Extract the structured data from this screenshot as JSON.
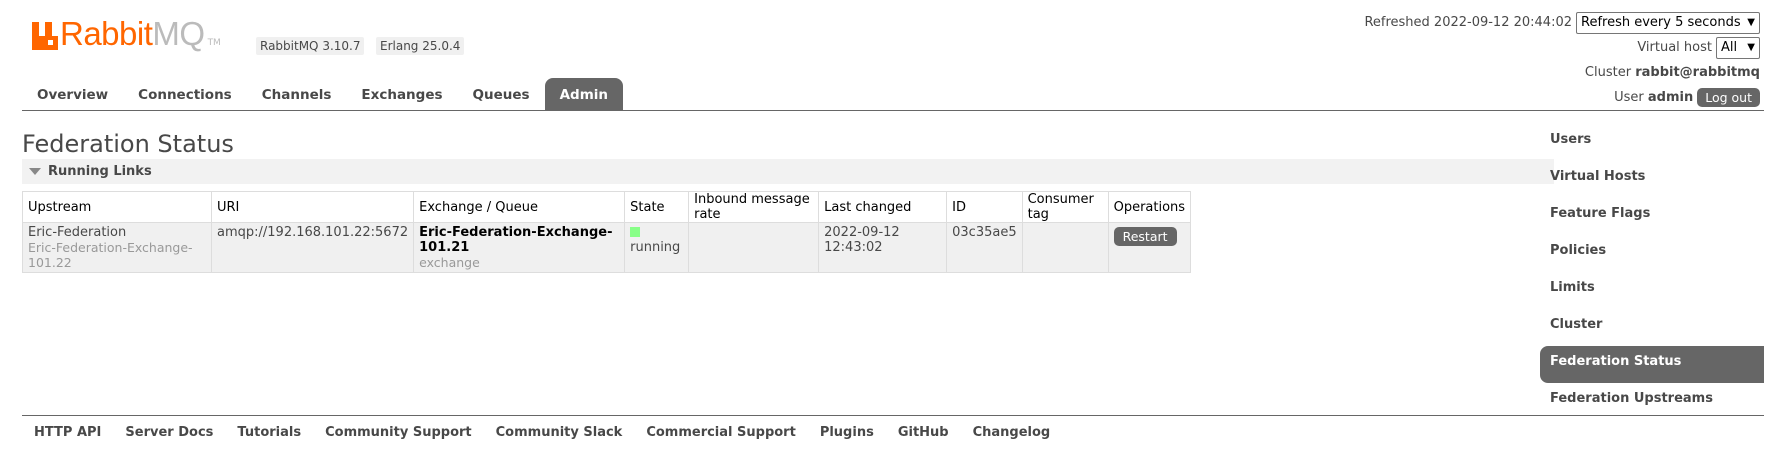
{
  "logo": {
    "rabbit": "Rabbit",
    "mq": "MQ",
    "tm": "TM"
  },
  "badges": {
    "rabbitmq": "RabbitMQ 3.10.7",
    "erlang": "Erlang 25.0.4"
  },
  "header": {
    "refreshed_label": "Refreshed",
    "refreshed_time": "2022-09-12 20:44:02",
    "refresh_select": "Refresh every 5 seconds",
    "vhost_label": "Virtual host",
    "vhost_select": "All",
    "cluster_label": "Cluster",
    "cluster_name": "rabbit@rabbitmq",
    "user_label": "User",
    "user_name": "admin",
    "logout": "Log out"
  },
  "tabs": [
    "Overview",
    "Connections",
    "Channels",
    "Exchanges",
    "Queues",
    "Admin"
  ],
  "active_tab": "Admin",
  "main": {
    "title": "Federation Status",
    "section": "Running Links",
    "columns": [
      "Upstream",
      "URI",
      "Exchange / Queue",
      "State",
      "Inbound message rate",
      "Last changed",
      "ID",
      "Consumer tag",
      "Operations"
    ],
    "rows": [
      {
        "upstream": "Eric-Federation",
        "upstream_sub": "Eric-Federation-Exchange-101.22",
        "uri": "amqp://192.168.101.22:5672",
        "exchange": "Eric-Federation-Exchange-101.21",
        "exchange_type": "exchange",
        "state": "running",
        "inbound_rate": "",
        "last_changed": "2022-09-12 12:43:02",
        "id": "03c35ae5",
        "consumer_tag": "",
        "operation": "Restart"
      }
    ]
  },
  "sidebar": [
    "Users",
    "Virtual Hosts",
    "Feature Flags",
    "Policies",
    "Limits",
    "Cluster",
    "Federation Status",
    "Federation Upstreams"
  ],
  "active_sidebar": "Federation Status",
  "footer": [
    "HTTP API",
    "Server Docs",
    "Tutorials",
    "Community Support",
    "Community Slack",
    "Commercial Support",
    "Plugins",
    "GitHub",
    "Changelog"
  ],
  "colors": {
    "brand": "#ff6600",
    "active_tab": "#666666",
    "running": "#88ff88"
  }
}
